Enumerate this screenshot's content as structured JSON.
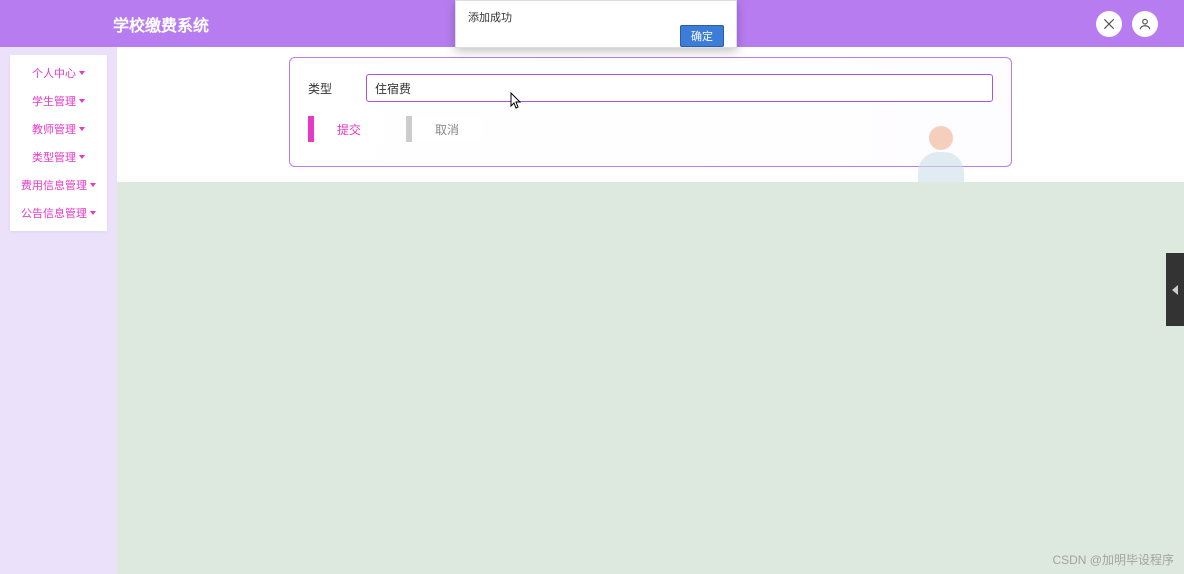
{
  "header": {
    "title": "学校缴费系统",
    "icons": [
      "fullscreen-icon",
      "user-icon"
    ]
  },
  "sidebar": {
    "items": [
      {
        "label": "个人中心"
      },
      {
        "label": "学生管理"
      },
      {
        "label": "教师管理"
      },
      {
        "label": "类型管理"
      },
      {
        "label": "费用信息管理"
      },
      {
        "label": "公告信息管理"
      }
    ]
  },
  "form": {
    "field_label": "类型",
    "field_value": "住宿费",
    "submit_label": "提交",
    "cancel_label": "取消"
  },
  "dialog": {
    "message": "添加成功",
    "ok_label": "确定"
  },
  "watermark": "CSDN @加明毕设程序"
}
